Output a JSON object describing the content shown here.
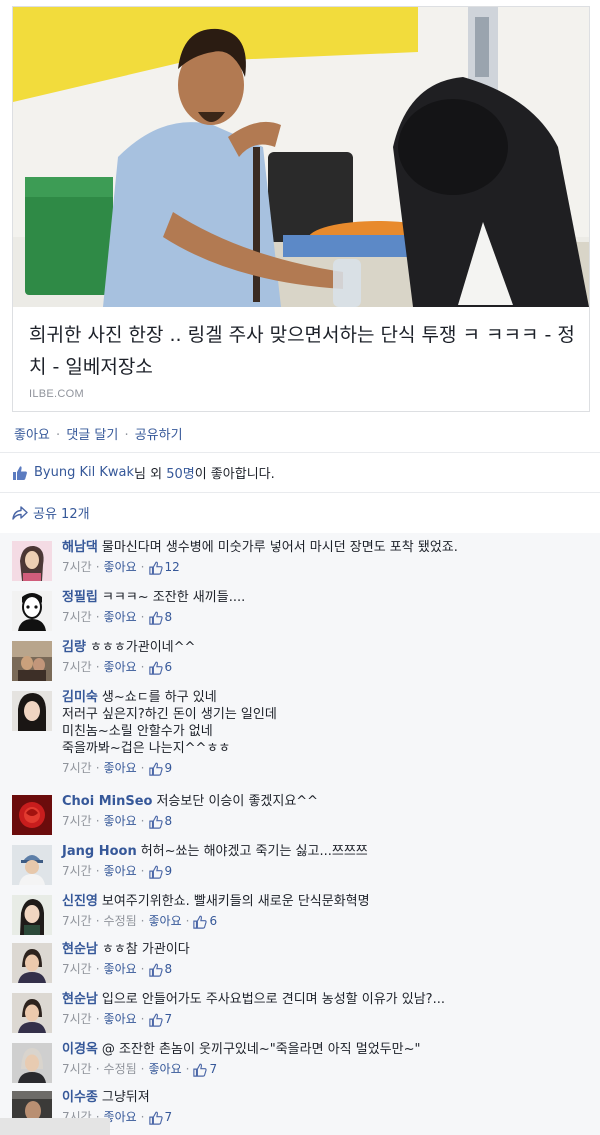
{
  "link_preview": {
    "title": "희귀한 사진 한장 .. 링겔 주사 맞으면서하는 단식 투쟁 ㅋ ㅋㅋㅋ - 정치 - 일베저장소",
    "domain": "ILBE.COM"
  },
  "post_actions": {
    "like": "좋아요",
    "comment": "댓글 달기",
    "share": "공유하기",
    "separator": "·"
  },
  "likes_summary": {
    "name": "Byung Kil Kwak",
    "suffix_1": "님 외 ",
    "count": "50명",
    "suffix_2": "이 좋아합니다."
  },
  "shares": {
    "label": "공유 12개"
  },
  "comments": [
    {
      "name": "해남댁",
      "text": "물마신다며 생수병에 미숫가루 넣어서 마시던 장면도 포착 됐었죠.",
      "time": "7시간",
      "edited": "",
      "like": "좋아요",
      "likes": "12"
    },
    {
      "name": "정필립",
      "text": "ㅋㅋㅋ~ 조잔한 새끼들....",
      "time": "7시간",
      "edited": "",
      "like": "좋아요",
      "likes": "8"
    },
    {
      "name": "김량",
      "text": "ㅎㅎㅎ가관이네^^",
      "time": "7시간",
      "edited": "",
      "like": "좋아요",
      "likes": "6"
    },
    {
      "name": "김미숙",
      "text": "생~쇼ㄷ를 하구 있네\n저러구 싶은지?하긴 돈이 생기는 일인데\n미친놈~소릴 안할수가 없네\n죽을까봐~겁은 나는지^^ㅎㅎ",
      "time": "7시간",
      "edited": "",
      "like": "좋아요",
      "likes": "9"
    },
    {
      "name": "Choi MinSeo",
      "text": "저승보단 이승이 좋겠지요^^",
      "time": "7시간",
      "edited": "",
      "like": "좋아요",
      "likes": "8"
    },
    {
      "name": "Jang Hoon",
      "text": "허허~쑈는 해야겠고 죽기는 싫고...쯔쯔쯔",
      "time": "7시간",
      "edited": "",
      "like": "좋아요",
      "likes": "9"
    },
    {
      "name": "신진영",
      "text": "보여주기위한쇼. 빨새키들의 새로운 단식문화혁명",
      "time": "7시간",
      "edited": "수정됨",
      "like": "좋아요",
      "likes": "6"
    },
    {
      "name": "현순남",
      "text": "ㅎㅎ참 가관이다",
      "time": "7시간",
      "edited": "",
      "like": "좋아요",
      "likes": "8"
    },
    {
      "name": "현순남",
      "text": "입으로 안들어가도 주사요법으로 견디며 농성할 이유가 있남?...",
      "time": "7시간",
      "edited": "",
      "like": "좋아요",
      "likes": "7"
    },
    {
      "name": "이경옥",
      "text": "@ 조잔한 촌놈이 웃끼구있네~\"죽을라면 아직 멀었두만~\"",
      "time": "7시간",
      "edited": "수정됨",
      "like": "좋아요",
      "likes": "7"
    },
    {
      "name": "이수종",
      "text": "그냥뒤져",
      "time": "7시간",
      "edited": "",
      "like": "좋아요",
      "likes": "7"
    }
  ],
  "colors": {
    "link_blue": "#365899",
    "meta_gray": "#90949c",
    "comment_bg": "#f6f7f9",
    "border": "#dddfe2"
  }
}
